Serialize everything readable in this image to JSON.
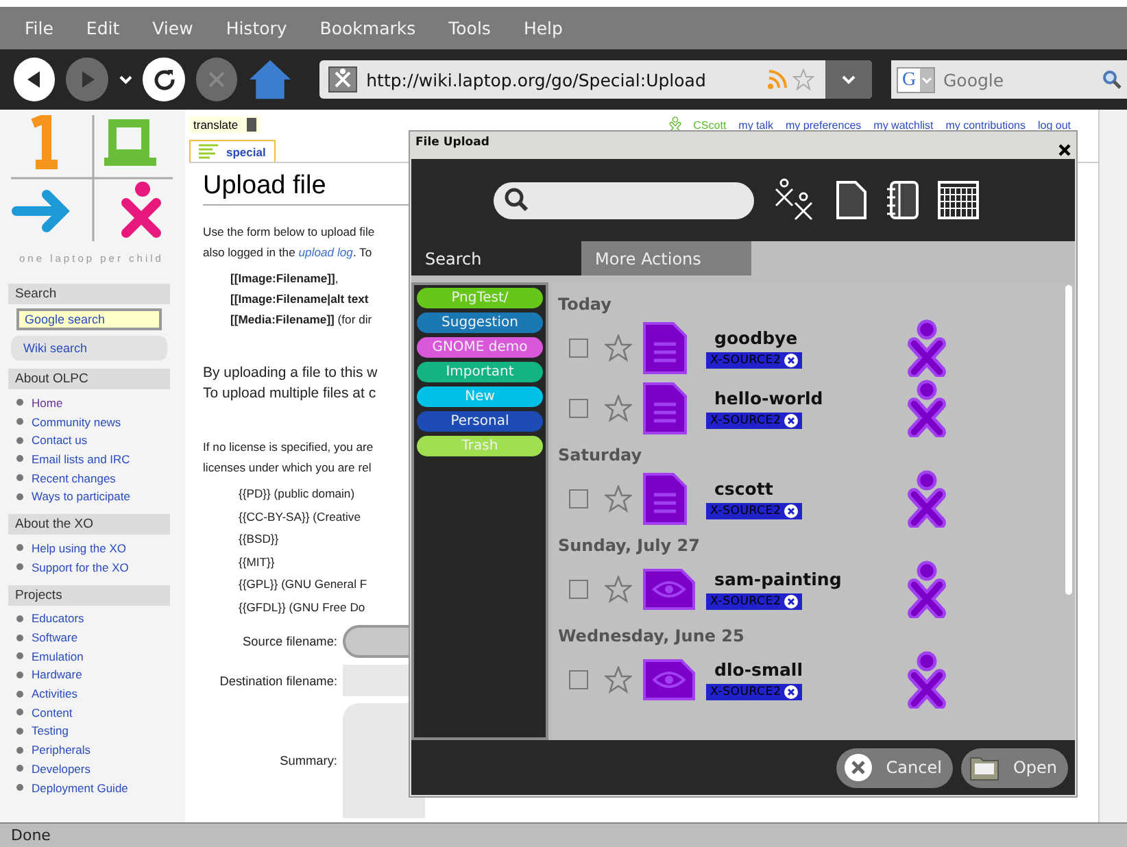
{
  "menu": [
    {
      "label": "File"
    },
    {
      "label": "Edit"
    },
    {
      "label": "View"
    },
    {
      "label": "History"
    },
    {
      "label": "Bookmarks"
    },
    {
      "label": "Tools"
    },
    {
      "label": "Help"
    }
  ],
  "nav_buttons": [
    {
      "kind": "back",
      "disabled": false
    },
    {
      "kind": "forward",
      "disabled": true
    },
    {
      "kind": "reload",
      "disabled": false
    },
    {
      "kind": "stop",
      "disabled": true
    },
    {
      "kind": "home",
      "disabled": false
    }
  ],
  "address_bar": {
    "url": "http://wiki.laptop.org/go/Special:Upload"
  },
  "search_bar": {
    "engine_letter": "G",
    "placeholder": "Google"
  },
  "sidebar": {
    "tagline": "one laptop per child",
    "search": {
      "title": "Search",
      "google_button": "Google search",
      "wiki_button": "Wiki search"
    },
    "sections": [
      {
        "title": "About OLPC",
        "links": [
          {
            "text": "Home",
            "visited": true
          },
          {
            "text": "Community news",
            "visited": false
          },
          {
            "text": "Contact us",
            "visited": false
          },
          {
            "text": "Email lists and IRC",
            "visited": false
          },
          {
            "text": "Recent changes",
            "visited": false
          },
          {
            "text": "Ways to participate",
            "visited": false
          }
        ]
      },
      {
        "title": "About the XO",
        "links": [
          {
            "text": "Help using the XO",
            "visited": false
          },
          {
            "text": "Support for the XO",
            "visited": false
          }
        ]
      },
      {
        "title": "Projects",
        "links": [
          {
            "text": "Educators",
            "visited": false
          },
          {
            "text": "Software",
            "visited": false
          },
          {
            "text": "Emulation",
            "visited": false
          },
          {
            "text": "Hardware",
            "visited": false
          },
          {
            "text": "Activities",
            "visited": false
          },
          {
            "text": "Content",
            "visited": false
          },
          {
            "text": "Testing",
            "visited": false
          },
          {
            "text": "Peripherals",
            "visited": false
          },
          {
            "text": "Developers",
            "visited": false
          },
          {
            "text": "Deployment Guide",
            "visited": false
          }
        ]
      }
    ]
  },
  "translate": "translate",
  "user_links": [
    {
      "text": "CScott",
      "kind": "user"
    },
    {
      "text": "my talk",
      "kind": "link"
    },
    {
      "text": "my preferences",
      "kind": "link"
    },
    {
      "text": "my watchlist",
      "kind": "link"
    },
    {
      "text": "my contributions",
      "kind": "link"
    },
    {
      "text": "log out",
      "kind": "link"
    }
  ],
  "page": {
    "tab": "special",
    "title": "Upload file",
    "intro": [
      {
        "before": "Use the form below to upload file"
      },
      {
        "before": "also logged in the ",
        "link": "upload log",
        "after": ". To"
      }
    ],
    "syntax": [
      "**[[Image:Filename]]**,",
      "**[[Image:Filename|alt text**",
      "**[[Media:Filename]]** (for dir"
    ],
    "notice": [
      "By uploading a file to this w",
      "To upload multiple files at c"
    ],
    "license_intro": [
      "If no license is specified, you are",
      "licenses under which you are rel"
    ],
    "licenses": [
      "{{PD}} (public domain)",
      "{{CC-BY-SA}} (Creative",
      "{{BSD}}",
      "{{MIT}}",
      "{{GPL}} (GNU General F",
      "{{GFDL}} (GNU Free Do"
    ],
    "form": [
      {
        "label": "Source filename:",
        "kind": "file"
      },
      {
        "label": "Destination filename:",
        "kind": "text"
      },
      {
        "label": "Summary:",
        "kind": "textarea"
      }
    ]
  },
  "dialog": {
    "title": "File Upload",
    "tabs": [
      {
        "label": "Search",
        "selected": true
      },
      {
        "label": "More Actions",
        "selected": false
      }
    ],
    "tags": [
      {
        "label": "PngTest/",
        "color": "#66c61a"
      },
      {
        "label": "Suggestion",
        "color": "#1a78b4"
      },
      {
        "label": "GNOME demo",
        "color": "#d957d9"
      },
      {
        "label": "Important",
        "color": "#14b482"
      },
      {
        "label": "New",
        "color": "#00c0e6"
      },
      {
        "label": "Personal",
        "color": "#1c4bb4"
      },
      {
        "label": "Trash",
        "color": "#a0e050"
      }
    ],
    "groups": [
      {
        "date": "Today",
        "entries": [
          {
            "name": "goodbye",
            "kind": "text",
            "tag": "X-SOURCE2",
            "checked": false,
            "starred": false
          },
          {
            "name": "hello-world",
            "kind": "text",
            "tag": "X-SOURCE2",
            "checked": false,
            "starred": false
          }
        ]
      },
      {
        "date": "Saturday",
        "entries": [
          {
            "name": "cscott",
            "kind": "text",
            "tag": "X-SOURCE2",
            "checked": false,
            "starred": false
          }
        ]
      },
      {
        "date": "Sunday, July 27",
        "entries": [
          {
            "name": "sam-painting",
            "kind": "image",
            "tag": "X-SOURCE2",
            "checked": false,
            "starred": false
          }
        ]
      },
      {
        "date": "Wednesday, June 25",
        "entries": [
          {
            "name": "dlo-small",
            "kind": "image",
            "tag": "X-SOURCE2",
            "checked": false,
            "starred": false
          }
        ]
      }
    ],
    "buttons": [
      {
        "label": "Cancel",
        "kind": "cancel"
      },
      {
        "label": "Open",
        "kind": "open"
      }
    ]
  },
  "status_bar": "Done"
}
